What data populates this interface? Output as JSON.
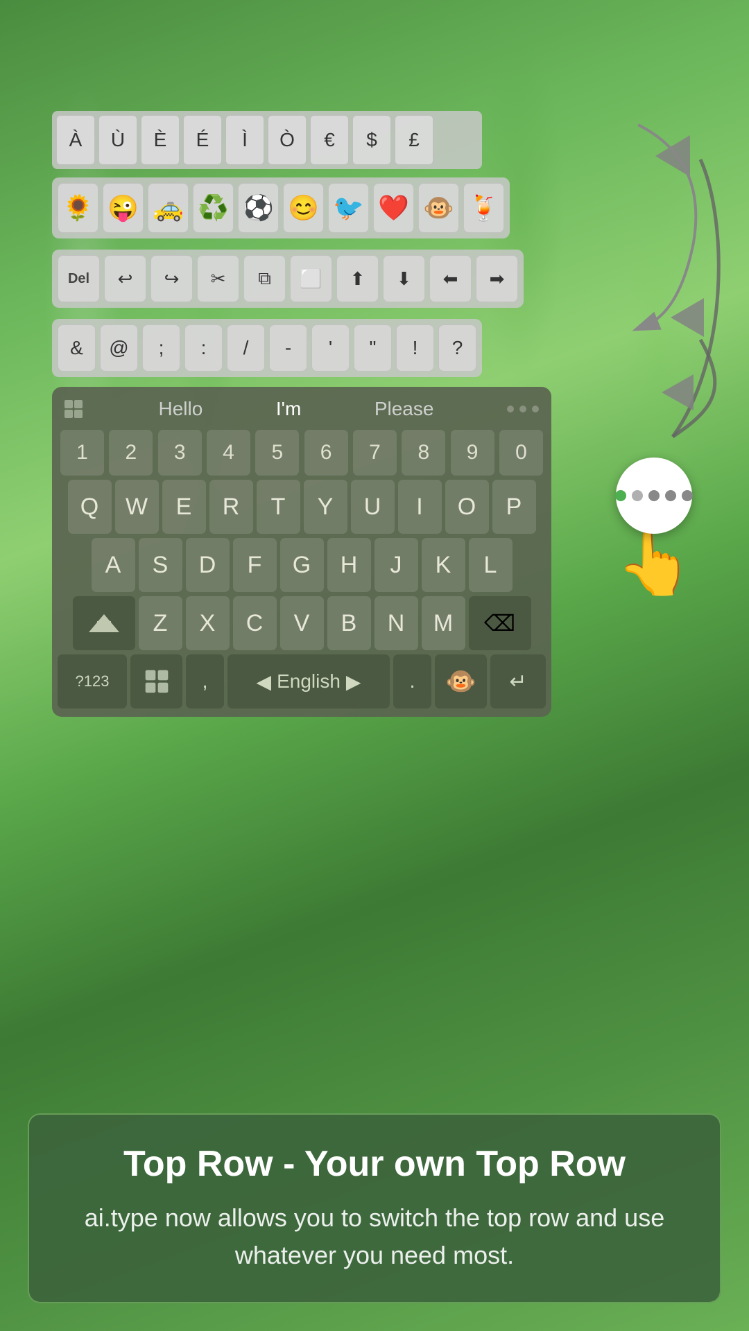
{
  "background": {
    "color": "green bamboo"
  },
  "special_chars_row": {
    "keys": [
      "À",
      "Ù",
      "È",
      "É",
      "Ì",
      "Ò",
      "€",
      "$",
      "£"
    ]
  },
  "emoji_row": {
    "emojis": [
      "🌻",
      "😜",
      "🚕",
      "♻️",
      "⚽",
      "😊",
      "🐦",
      "❤️",
      "🐵",
      "🍹"
    ]
  },
  "edit_row": {
    "keys": [
      "Del",
      "↩",
      "↪",
      "✂",
      "⧉",
      "⬜",
      "⬆",
      "⬇",
      "⬅",
      "➡"
    ]
  },
  "symbol_row": {
    "keys": [
      "&",
      "@",
      ";",
      ":",
      "/",
      "-",
      "'",
      "\"",
      "!",
      "?"
    ]
  },
  "suggestions": {
    "words": [
      "Hello",
      "I'm",
      "Please"
    ],
    "dots": [
      false,
      false,
      false
    ]
  },
  "number_row": {
    "keys": [
      "1",
      "2",
      "3",
      "4",
      "5",
      "6",
      "7",
      "8",
      "9",
      "0"
    ]
  },
  "letter_rows": {
    "row1": [
      "Q",
      "W",
      "E",
      "R",
      "T",
      "Y",
      "U",
      "I",
      "O",
      "P"
    ],
    "row2": [
      "A",
      "S",
      "D",
      "F",
      "G",
      "H",
      "J",
      "K",
      "L"
    ],
    "row3": [
      "Z",
      "X",
      "C",
      "V",
      "B",
      "N",
      "M"
    ]
  },
  "action_row": {
    "num_switch": "?123",
    "layout_switch": "⊞",
    "comma": ",",
    "lang_left": "◀",
    "lang_label": "English",
    "lang_right": "▶",
    "period": ".",
    "emoji": "🐵",
    "enter": "↵"
  },
  "info_box": {
    "title": "Top Row - Your own Top Row",
    "description": "ai.type now allows you to switch the top row and use whatever you need most."
  },
  "cursor_indicator": {
    "dots": [
      "green",
      "lgray",
      "gray",
      "gray",
      "gray"
    ]
  }
}
